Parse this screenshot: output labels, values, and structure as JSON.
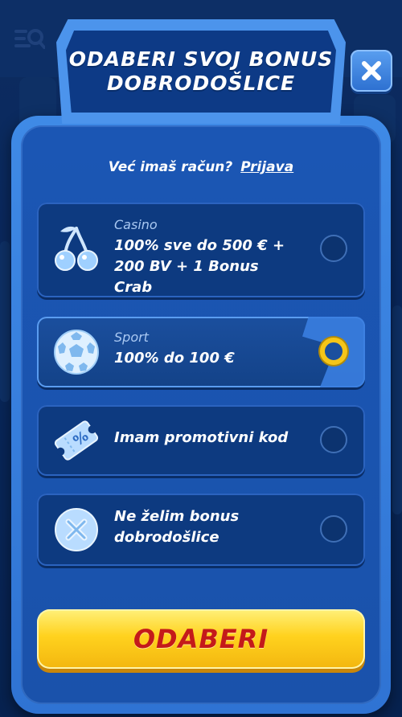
{
  "modal": {
    "title_line1": "ODABERI SVOJ BONUS",
    "title_line2": "DOBRODOŠLICE",
    "close_icon": "close-icon",
    "login_prompt": "Već imaš račun?",
    "login_link": "Prijava"
  },
  "options": [
    {
      "category": "Casino",
      "offer_line1": "100% sve do 500 € +",
      "offer_line2": "200 BV + 1 Bonus Crab",
      "icon": "cherries-icon",
      "selected": false
    },
    {
      "category": "Sport",
      "offer_line1": "100% do 100 €",
      "icon": "soccer-ball-icon",
      "selected": true
    },
    {
      "offer_line1": "Imam promotivni kod",
      "icon": "promo-ticket-icon",
      "selected": false
    },
    {
      "offer_line1": "Ne želim bonus",
      "offer_line2": "dobrodošlice",
      "icon": "no-bonus-x-icon",
      "selected": false
    }
  ],
  "cta": {
    "label": "ODABERI"
  },
  "colors": {
    "panel_blue": "#1b56b4",
    "frame_blue": "#3f8ae6",
    "selected_ring": "#f5c518",
    "cta_yellow": "#ffd21e",
    "cta_text_red": "#c41a1a"
  }
}
